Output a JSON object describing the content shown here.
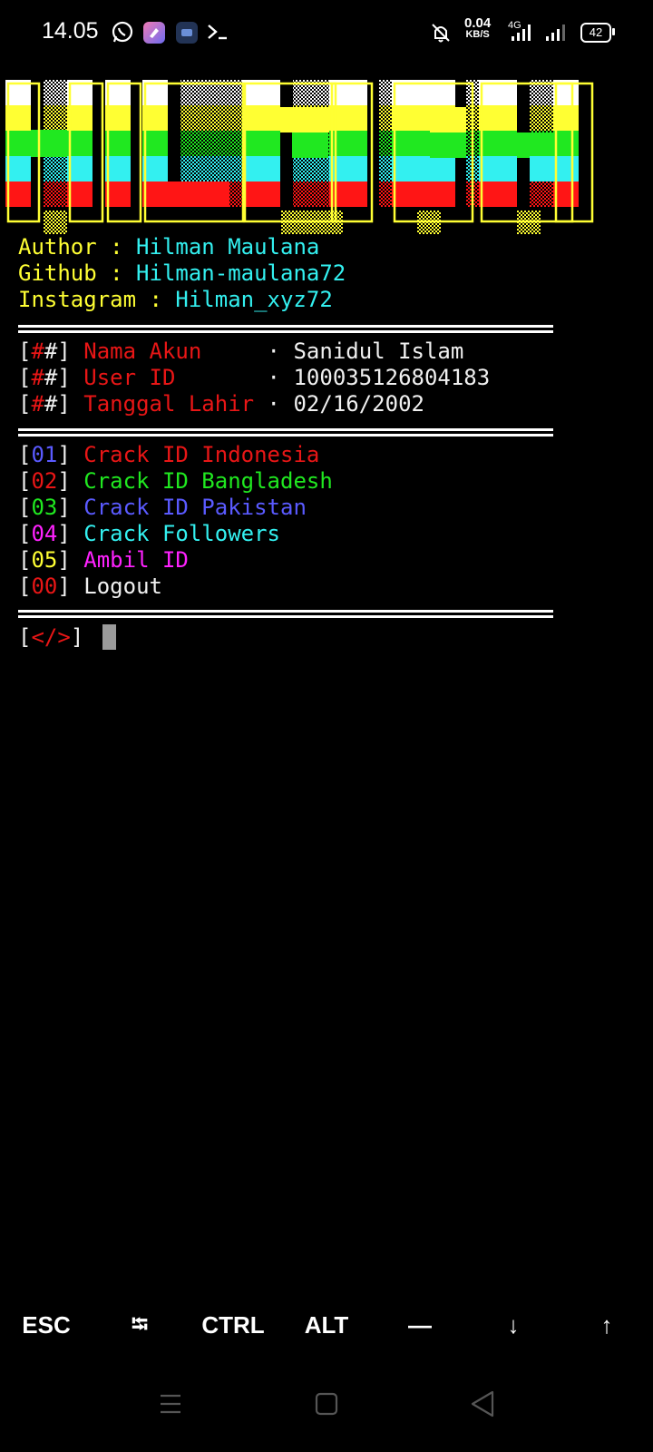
{
  "status_bar": {
    "time": "14.05",
    "speed_value": "0.04",
    "speed_unit": "KB/S",
    "network": "4G",
    "battery": "42",
    "icons": [
      "whatsapp-icon",
      "app-icon-purple",
      "app-icon-dark",
      "terminal-icon",
      "mute-icon",
      "signal-icon",
      "signal-icon-2",
      "battery-icon"
    ]
  },
  "banner": {
    "logo_text": "HILMAN",
    "colors": [
      "#ffffff",
      "#ffff33",
      "#20e820",
      "#33f0f0",
      "#ff1515"
    ]
  },
  "info": {
    "author_label": "Author : ",
    "author_value": "Hilman Maulana",
    "github_label": "Github : ",
    "github_value": "Hilman-maulana72",
    "instagram_label": "Instagram : ",
    "instagram_value": "Hilman_xyz72"
  },
  "account": {
    "rows": [
      {
        "label": "Nama Akun    ",
        "value": "Sanidul Islam"
      },
      {
        "label": "User ID      ",
        "value": "100035126804183"
      },
      {
        "label": "Tanggal Lahir",
        "value": "02/16/2002"
      }
    ],
    "dot": " · "
  },
  "menu": {
    "items": [
      {
        "num": "01",
        "label": "Crack ID Indonesia"
      },
      {
        "num": "02",
        "label": "Crack ID Bangladesh"
      },
      {
        "num": "03",
        "label": "Crack ID Pakistan"
      },
      {
        "num": "04",
        "label": "Crack Followers"
      },
      {
        "num": "05",
        "label": "Ambil ID"
      },
      {
        "num": "00",
        "label": "Logout"
      }
    ]
  },
  "prompt": {
    "symbol": "</>"
  },
  "extra_keys": [
    "ESC",
    "⭾",
    "CTRL",
    "ALT",
    "—",
    "↓",
    "↑"
  ]
}
